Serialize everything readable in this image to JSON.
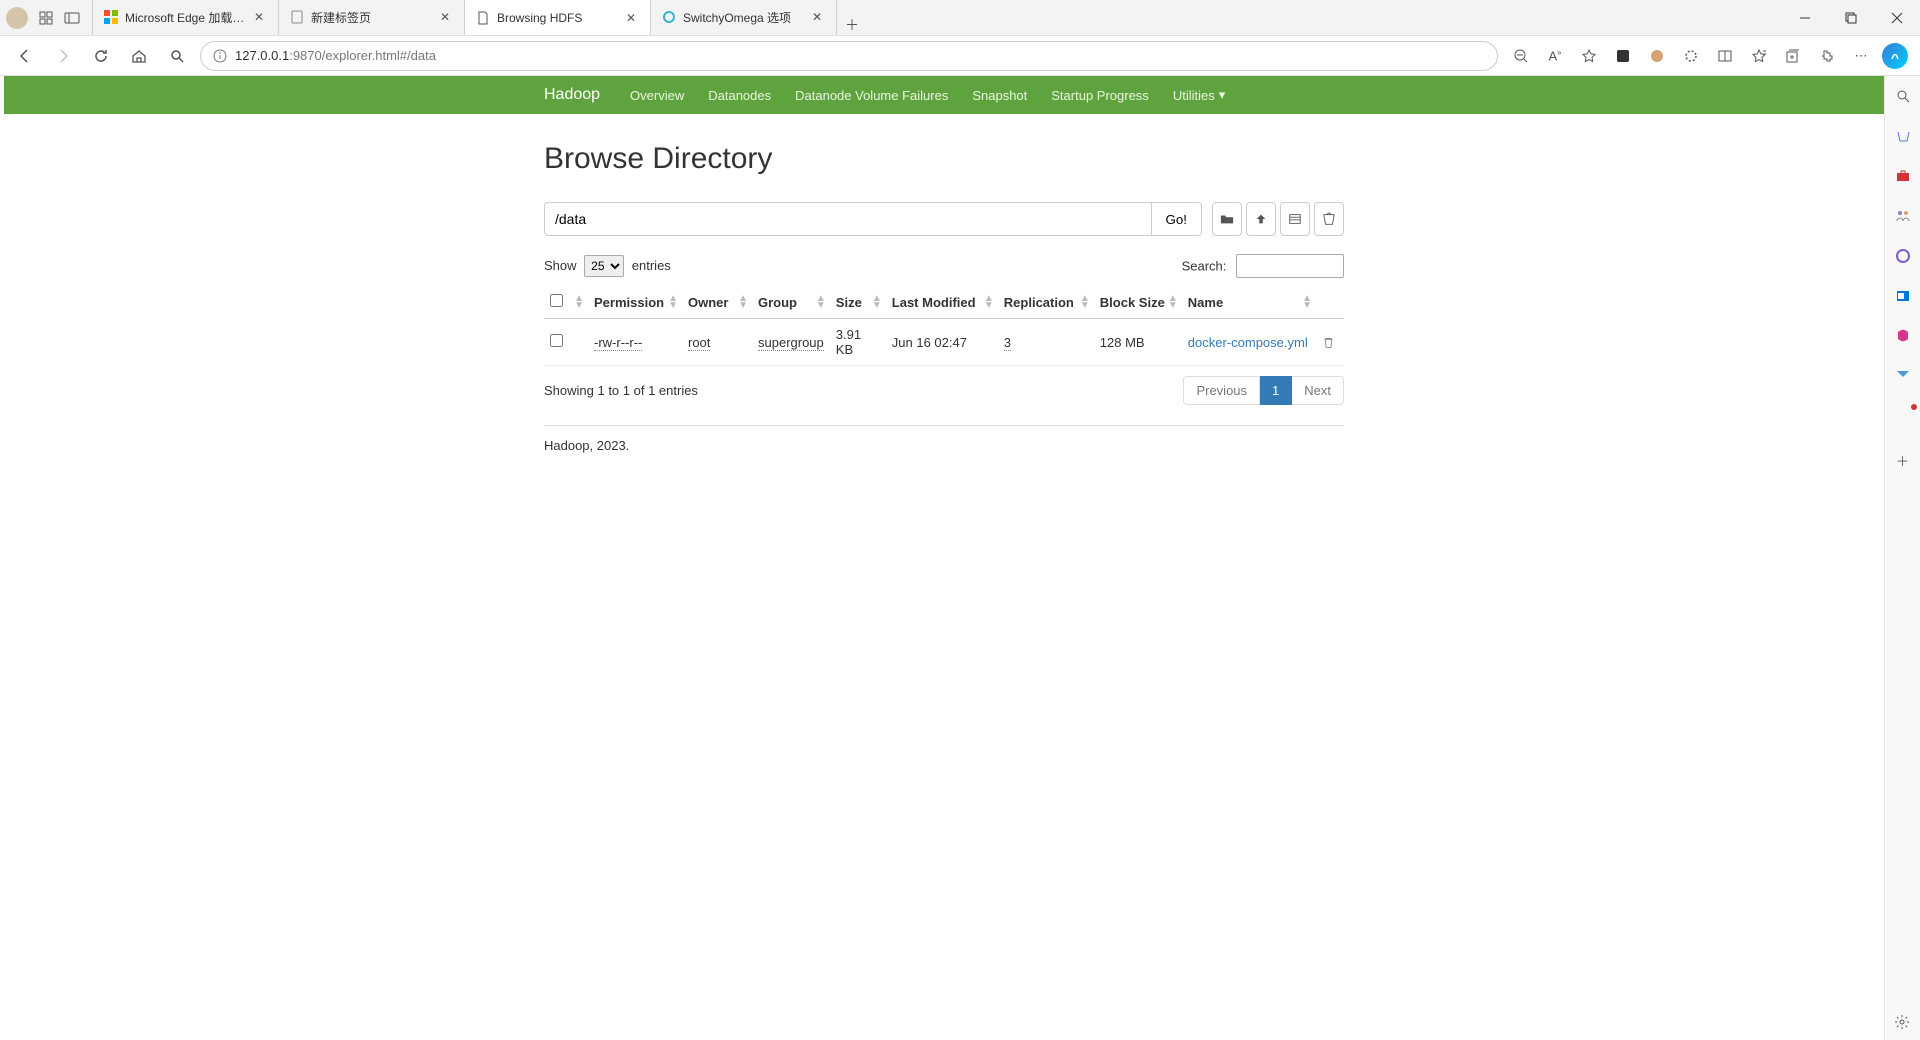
{
  "browser": {
    "tabs": [
      {
        "title": "Microsoft Edge 加载项 - Switchy"
      },
      {
        "title": "新建标签页"
      },
      {
        "title": "Browsing HDFS"
      },
      {
        "title": "SwitchyOmega 选项"
      }
    ],
    "url_host": "127.0.0.1",
    "url_path": ":9870/explorer.html#/data"
  },
  "navbar": {
    "brand": "Hadoop",
    "links": [
      "Overview",
      "Datanodes",
      "Datanode Volume Failures",
      "Snapshot",
      "Startup Progress",
      "Utilities"
    ]
  },
  "page": {
    "heading": "Browse Directory",
    "path_value": "/data",
    "go_label": "Go!",
    "show_label_prefix": "Show",
    "show_label_suffix": "entries",
    "entries_options": [
      "25"
    ],
    "entries_selected": "25",
    "search_label": "Search:",
    "columns": [
      "Permission",
      "Owner",
      "Group",
      "Size",
      "Last Modified",
      "Replication",
      "Block Size",
      "Name"
    ],
    "rows": [
      {
        "permission": "-rw-r--r--",
        "owner": "root",
        "group": "supergroup",
        "size": "3.91 KB",
        "modified": "Jun 16 02:47",
        "replication": "3",
        "blocksize": "128 MB",
        "name": "docker-compose.yml"
      }
    ],
    "showing_text": "Showing 1 to 1 of 1 entries",
    "pagination": {
      "prev": "Previous",
      "page": "1",
      "next": "Next"
    },
    "footer": "Hadoop, 2023."
  }
}
